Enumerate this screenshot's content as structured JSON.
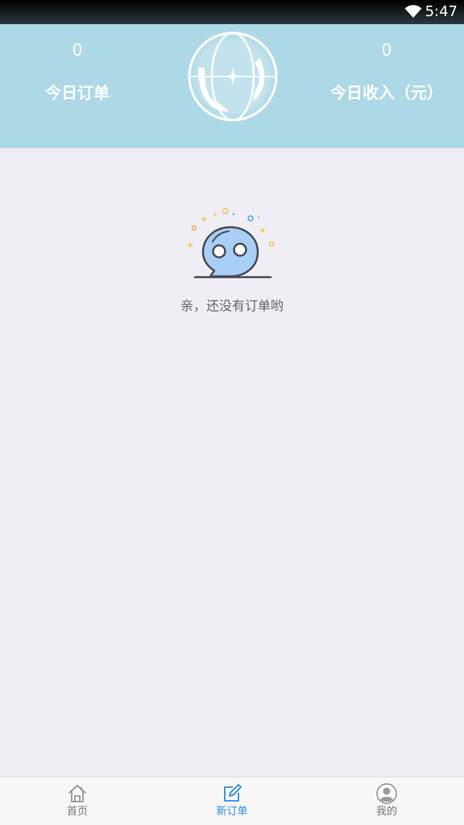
{
  "status_bar": {
    "time": "5:47",
    "wifi_icon": "wifi-icon"
  },
  "header": {
    "today_orders": {
      "value": "0",
      "label": "今日订单"
    },
    "today_income": {
      "value": "0",
      "label": "今日收入（元）"
    },
    "logo_icon": "globe-logo",
    "background_color": "#add8e6"
  },
  "empty_state": {
    "icon": "speech-bubble-face-icon",
    "message": "亲，还没有订单哟"
  },
  "bottom_nav": {
    "active_color": "#2f8ae0",
    "items": [
      {
        "label": "首页",
        "icon": "home-icon",
        "active": false
      },
      {
        "label": "新订单",
        "icon": "edit-order-icon",
        "active": true
      },
      {
        "label": "我的",
        "icon": "user-avatar-icon",
        "active": false
      }
    ]
  }
}
